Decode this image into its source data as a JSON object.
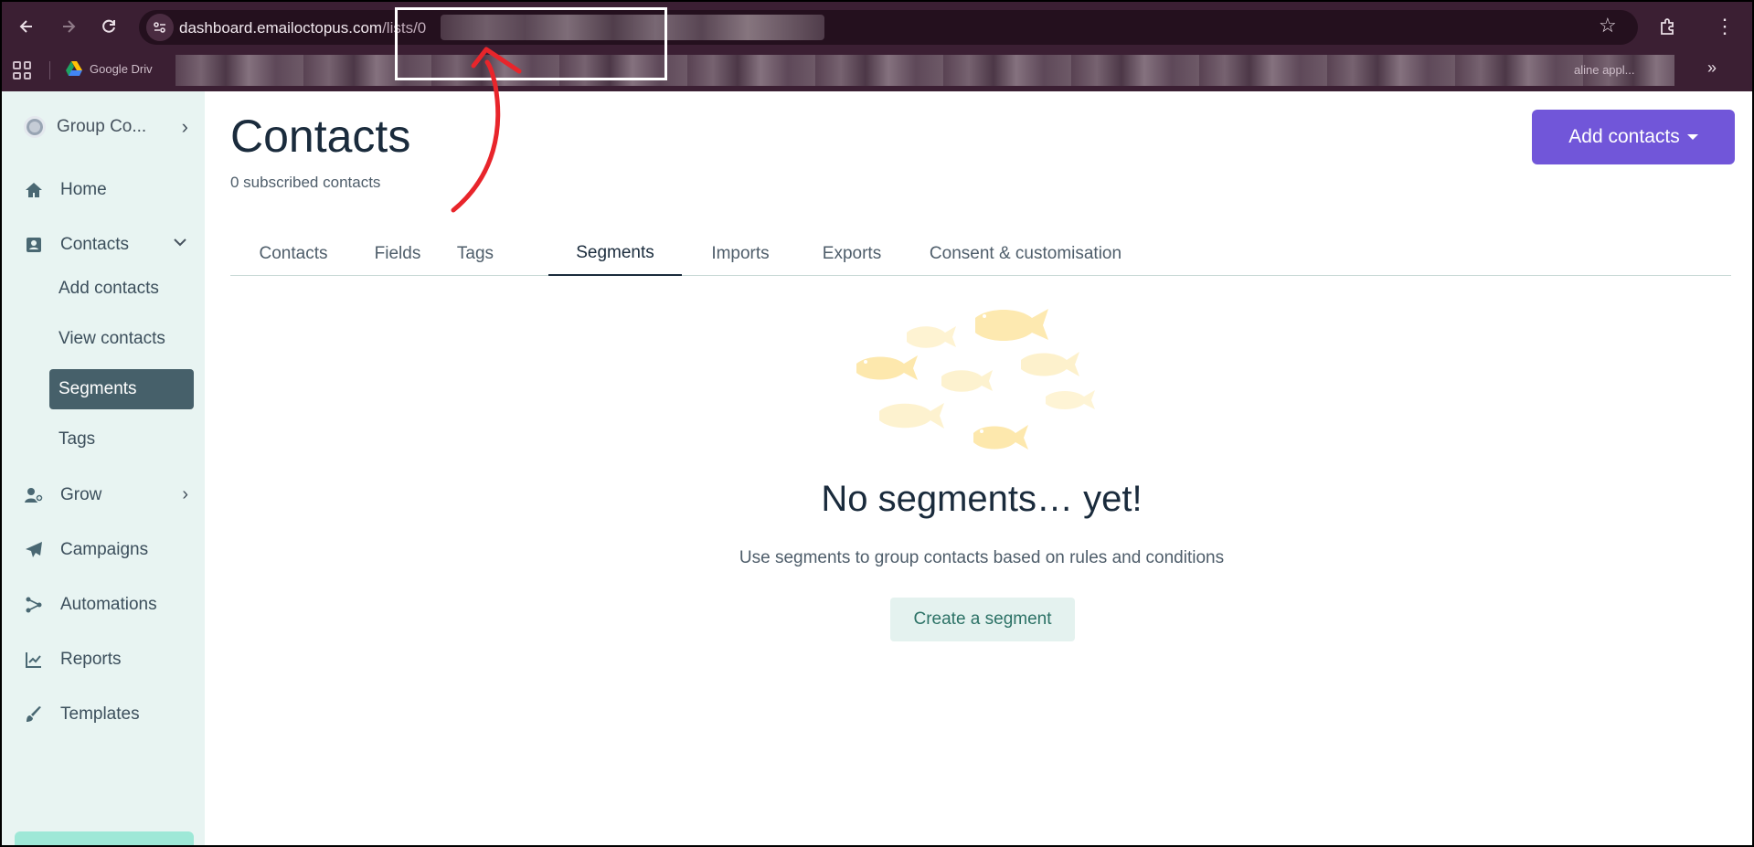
{
  "browser": {
    "url_host": "dashboard.emailoctopus.com",
    "url_path": "/lists/0",
    "bookmark_first": "Google Driv",
    "bookmark_tail": "aline appl...",
    "icons": [
      "back-icon",
      "forward-icon",
      "reload-icon",
      "site-info-icon",
      "star-icon",
      "extensions-icon",
      "menu-icon",
      "apps-icon",
      "google-drive-icon",
      "chevron-right-icon"
    ]
  },
  "sidebar": {
    "org_name": "Group Co...",
    "items": [
      {
        "label": "Home",
        "icon": "home-icon"
      },
      {
        "label": "Contacts",
        "icon": "contacts-icon"
      },
      {
        "label": "Grow",
        "icon": "grow-icon"
      },
      {
        "label": "Campaigns",
        "icon": "paper-plane-icon"
      },
      {
        "label": "Automations",
        "icon": "automations-icon"
      },
      {
        "label": "Reports",
        "icon": "chart-icon"
      },
      {
        "label": "Templates",
        "icon": "brush-icon"
      }
    ],
    "contacts_sub": [
      {
        "label": "Add contacts"
      },
      {
        "label": "View contacts"
      },
      {
        "label": "Segments",
        "active": true
      },
      {
        "label": "Tags"
      }
    ]
  },
  "main": {
    "title": "Contacts",
    "subtitle": "0 subscribed contacts",
    "add_contacts_label": "Add contacts",
    "tabs": [
      {
        "label": "Contacts"
      },
      {
        "label": "Fields"
      },
      {
        "label": "Tags"
      },
      {
        "label": "Segments",
        "active": true
      },
      {
        "label": "Imports"
      },
      {
        "label": "Exports"
      },
      {
        "label": "Consent & customisation"
      }
    ],
    "empty_title": "No segments… yet!",
    "empty_desc": "Use segments to group contacts based on rules and conditions",
    "create_label": "Create a segment"
  },
  "colors": {
    "accent": "#7156d9",
    "sidebar_bg": "#e8f4f2",
    "active_item": "#46606a",
    "chrome_bg": "#3b1f33",
    "fish": "#fdefc3",
    "annotation": "#e8252b"
  }
}
